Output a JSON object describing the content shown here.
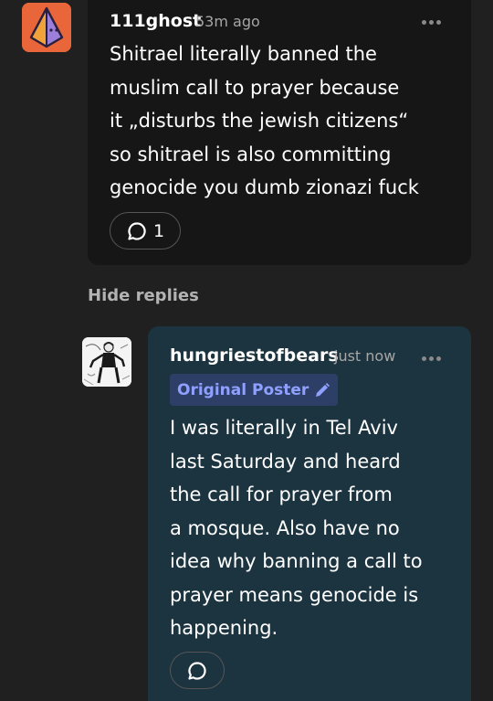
{
  "comment": {
    "username": "111ghost",
    "timestamp": "53m ago",
    "lines": [
      "Shitrael literally banned the",
      "muslim call to prayer because",
      "it „disturbs the jewish citizens“",
      "so shitrael is also committing",
      "genocide you dumb zionazi fuck"
    ],
    "reply_count": "1",
    "avatar_icon": "pyramid-avatar-icon",
    "more_icon": "ellipsis-icon",
    "reply_icon": "speech-bubble-icon"
  },
  "thread": {
    "hide_replies_label": "Hide replies"
  },
  "reply": {
    "username": "hungriestofbears",
    "timestamp": "just now",
    "badge_label": "Original Poster",
    "badge_icon": "pencil-icon",
    "lines": [
      "I was literally in Tel Aviv",
      "last Saturday and heard",
      "the call for prayer from",
      "a mosque. Also have no",
      "idea why banning a call to",
      "prayer means genocide is",
      "happening."
    ],
    "avatar_icon": "sketch-figure-avatar",
    "more_icon": "ellipsis-icon",
    "reply_icon": "speech-bubble-icon"
  },
  "colors": {
    "background": "#202020",
    "comment_bubble": "#161616",
    "reply_bubble": "#1c3440",
    "avatar_orange": "#e8663a",
    "badge_background": "#2d3f66",
    "badge_text": "#8fa0ff"
  }
}
